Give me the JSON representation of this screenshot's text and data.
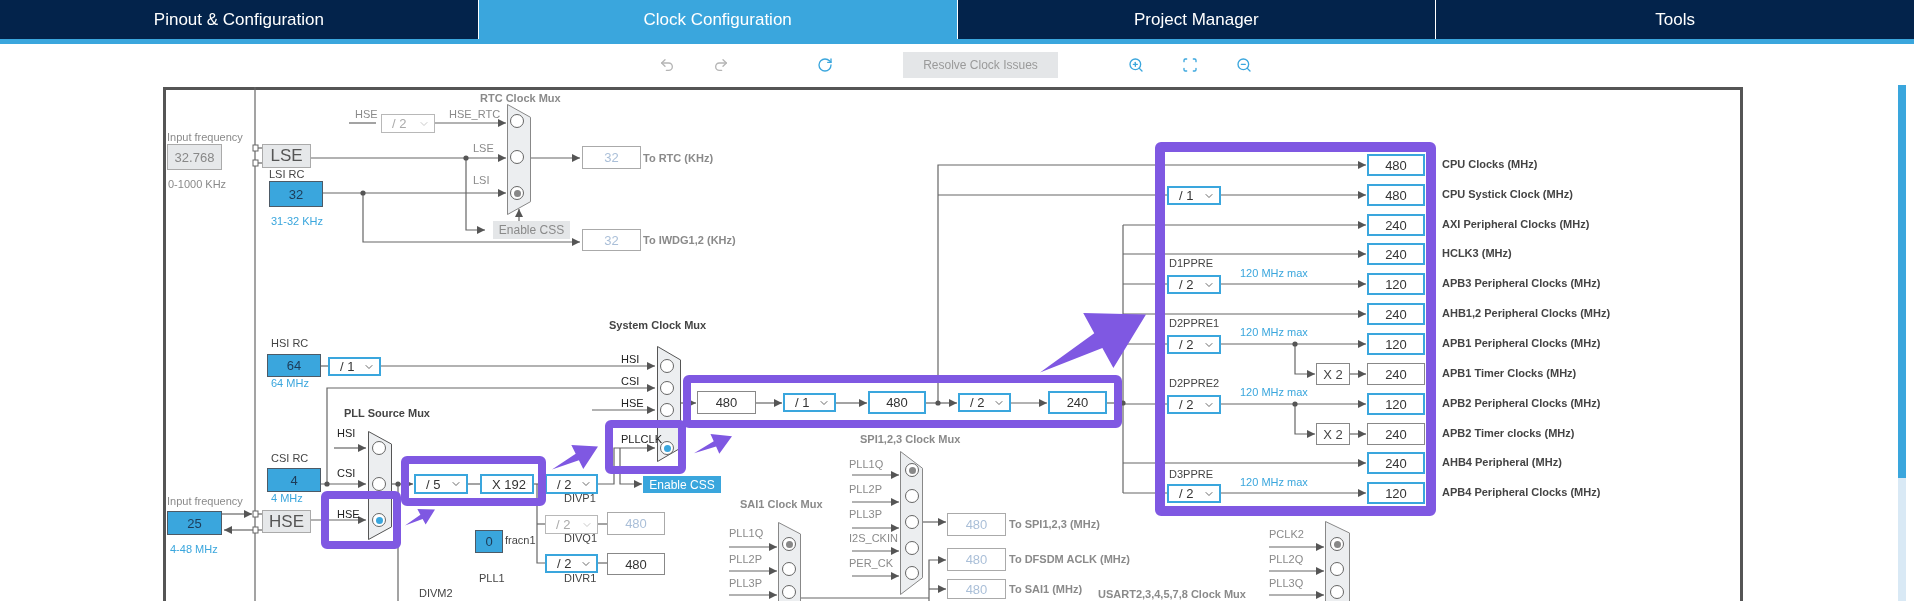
{
  "tabs": [
    {
      "label": "Pinout & Configuration",
      "selected": false
    },
    {
      "label": "Clock Configuration",
      "selected": true
    },
    {
      "label": "Project Manager",
      "selected": false
    },
    {
      "label": "Tools",
      "selected": false
    }
  ],
  "toolbar": {
    "resolve_button": {
      "label": "Resolve Clock Issues",
      "disabled": true
    }
  },
  "labels": [
    {
      "text": "Input frequency",
      "kind": "caption"
    },
    {
      "text": "0-1000 KHz",
      "kind": "caption"
    },
    {
      "text": "LSI RC",
      "kind": "name"
    },
    {
      "text": "31-32 KHz",
      "kind": "range"
    },
    {
      "text": "HSE",
      "kind": "caption"
    },
    {
      "text": "To RTC (KHz)",
      "kind": "dest_muted"
    },
    {
      "text": "To IWDG1,2 (KHz)",
      "kind": "dest_muted"
    },
    {
      "text": "HSI RC",
      "kind": "name"
    },
    {
      "text": "64 MHz",
      "kind": "range"
    },
    {
      "text": "CSI RC",
      "kind": "name"
    },
    {
      "text": "Input frequency",
      "kind": "caption"
    },
    {
      "text": "4 MHz",
      "kind": "range"
    },
    {
      "text": "4-48 MHz",
      "kind": "range"
    },
    {
      "text": "DIVP1",
      "kind": "name"
    },
    {
      "text": "DIVQ1",
      "kind": "name"
    },
    {
      "text": "DIVR1",
      "kind": "name"
    },
    {
      "text": "fracn1",
      "kind": "name"
    },
    {
      "text": "PLL1",
      "kind": "name"
    },
    {
      "text": "DIVM2",
      "kind": "name"
    },
    {
      "text": "To SPI1,2,3 (MHz)",
      "kind": "dest_muted"
    },
    {
      "text": "To DFSDM ACLK (MHz)",
      "kind": "dest_muted"
    },
    {
      "text": "To SAI1 (MHz)",
      "kind": "dest_muted"
    },
    {
      "text": "D1PPRE",
      "kind": "name"
    },
    {
      "text": "D2PPRE1",
      "kind": "name"
    },
    {
      "text": "D2PPRE2",
      "kind": "name"
    },
    {
      "text": "D3PPRE",
      "kind": "name"
    },
    {
      "text": "120 MHz max",
      "kind": "range"
    },
    {
      "text": "120 MHz max",
      "kind": "range"
    },
    {
      "text": "120 MHz max",
      "kind": "range"
    },
    {
      "text": "120 MHz max",
      "kind": "range"
    }
  ],
  "inputs": [
    {
      "value": "32.768",
      "kind": "fixed"
    },
    {
      "value": "LSE",
      "kind": "block"
    },
    {
      "value": "32",
      "kind": "source"
    },
    {
      "value": "64",
      "kind": "source"
    },
    {
      "value": "4",
      "kind": "source"
    },
    {
      "value": "25",
      "kind": "source"
    },
    {
      "value": "HSE",
      "kind": "block"
    },
    {
      "value": "0",
      "kind": "source"
    }
  ],
  "dropdowns": [
    {
      "value": "/ 2",
      "disabled": true
    },
    {
      "value": "/ 1",
      "disabled": false
    },
    {
      "value": "/ 5",
      "disabled": false
    },
    {
      "value": "X 192",
      "disabled": false
    },
    {
      "value": "/ 2",
      "disabled": false
    },
    {
      "value": "/ 2",
      "disabled": true
    },
    {
      "value": "/ 2",
      "disabled": false
    },
    {
      "value": "/ 1",
      "disabled": false
    },
    {
      "value": "/ 2",
      "disabled": false
    },
    {
      "value": "/ 1",
      "disabled": false
    },
    {
      "value": "/ 2",
      "disabled": false
    },
    {
      "value": "/ 2",
      "disabled": false
    },
    {
      "value": "/ 2",
      "disabled": false
    },
    {
      "value": "/ 2",
      "disabled": false
    }
  ],
  "outputs": [
    {
      "value": "32",
      "kind": "disabled"
    },
    {
      "value": "32",
      "kind": "disabled"
    },
    {
      "value": "480",
      "kind": "disabled"
    },
    {
      "value": "480",
      "kind": "plain"
    },
    {
      "value": "480",
      "kind": "plain"
    },
    {
      "value": "480",
      "kind": "active"
    },
    {
      "value": "240",
      "kind": "active"
    },
    {
      "value": "480",
      "kind": "disabled"
    },
    {
      "value": "480",
      "kind": "disabled"
    },
    {
      "value": "480",
      "kind": "disabled"
    }
  ],
  "clock_outputs": [
    {
      "value": "480",
      "label": "CPU Clocks (MHz)",
      "kind": "active"
    },
    {
      "value": "480",
      "label": "CPU Systick Clock (MHz)",
      "kind": "active"
    },
    {
      "value": "240",
      "label": "AXI Peripheral Clocks (MHz)",
      "kind": "active"
    },
    {
      "value": "240",
      "label": "HCLK3 (MHz)",
      "kind": "active"
    },
    {
      "value": "120",
      "label": "APB3 Peripheral Clocks (MHz)",
      "kind": "active"
    },
    {
      "value": "240",
      "label": "AHB1,2 Peripheral Clocks (MHz)",
      "kind": "active"
    },
    {
      "value": "120",
      "label": "APB1 Peripheral Clocks (MHz)",
      "kind": "active"
    },
    {
      "value": "240",
      "label": "APB1 Timer Clocks (MHz)",
      "kind": "plain"
    },
    {
      "value": "120",
      "label": "APB2 Peripheral Clocks (MHz)",
      "kind": "active"
    },
    {
      "value": "240",
      "label": "APB2 Timer clocks (MHz)",
      "kind": "plain"
    },
    {
      "value": "240",
      "label": "AHB4 Peripheral (MHz)",
      "kind": "active"
    },
    {
      "value": "120",
      "label": "APB4 Peripheral Clocks (MHz)",
      "kind": "active"
    }
  ],
  "multipliers": [
    "X 2",
    "X 2"
  ],
  "buttons": [
    {
      "label": "Enable CSS",
      "disabled": true
    },
    {
      "label": "Enable CSS",
      "disabled": false
    }
  ],
  "muxes": [
    {
      "title": "RTC Clock Mux",
      "active": false,
      "inputs": [
        {
          "label": "HSE_RTC",
          "selected": false
        },
        {
          "label": "LSE",
          "selected": false
        },
        {
          "label": "LSI",
          "selected": true
        }
      ]
    },
    {
      "title": "System Clock Mux",
      "active": true,
      "inputs": [
        {
          "label": "HSI",
          "selected": false
        },
        {
          "label": "CSI",
          "selected": false
        },
        {
          "label": "HSE",
          "selected": false
        },
        {
          "label": "PLLCLK",
          "selected": true
        }
      ]
    },
    {
      "title": "PLL Source Mux",
      "active": true,
      "inputs": [
        {
          "label": "HSI",
          "selected": false
        },
        {
          "label": "CSI",
          "selected": false
        },
        {
          "label": "HSE",
          "selected": true
        }
      ]
    },
    {
      "title": "SPI1,2,3 Clock Mux",
      "active": false,
      "inputs": [
        {
          "label": "PLL1Q",
          "selected": true
        },
        {
          "label": "PLL2P",
          "selected": false
        },
        {
          "label": "PLL3P",
          "selected": false
        },
        {
          "label": "I2S_CKIN",
          "selected": false
        },
        {
          "label": "PER_CK",
          "selected": false
        }
      ]
    },
    {
      "title": "SAI1 Clock Mux",
      "active": false,
      "inputs": [
        {
          "label": "PLL1Q",
          "selected": true
        },
        {
          "label": "PLL2P",
          "selected": false
        },
        {
          "label": "PLL3P",
          "selected": false
        }
      ]
    },
    {
      "title": "USART2,3,4,5,7,8 Clock Mux",
      "active": false,
      "inputs": [
        {
          "label": "PCLK2",
          "selected": true
        },
        {
          "label": "PLL2Q",
          "selected": false
        },
        {
          "label": "PLL3Q",
          "selected": false
        }
      ]
    }
  ]
}
